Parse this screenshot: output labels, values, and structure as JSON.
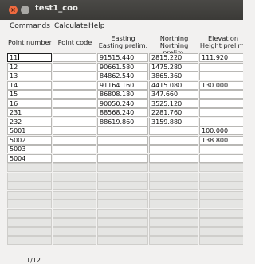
{
  "window": {
    "title": "test1_coo"
  },
  "menu": {
    "items": [
      "Commands",
      "Calculate",
      "Help"
    ]
  },
  "table": {
    "headers": [
      {
        "line1": "Point number",
        "line2": ""
      },
      {
        "line1": "Point code",
        "line2": ""
      },
      {
        "line1": "Easting",
        "line2": "Easting prelim."
      },
      {
        "line1": "Northing",
        "line2": "Northing prelim."
      },
      {
        "line1": "Elevation",
        "line2": "Height prelim."
      }
    ],
    "rows": [
      [
        "11",
        "",
        "91515.440",
        "2815.220",
        "111.920"
      ],
      [
        "12",
        "",
        "90661.580",
        "1475.280",
        ""
      ],
      [
        "13",
        "",
        "84862.540",
        "3865.360",
        ""
      ],
      [
        "14",
        "",
        "91164.160",
        "4415.080",
        "130.000"
      ],
      [
        "15",
        "",
        "86808.180",
        "347.660",
        ""
      ],
      [
        "16",
        "",
        "90050.240",
        "3525.120",
        ""
      ],
      [
        "231",
        "",
        "88568.240",
        "2281.760",
        ""
      ],
      [
        "232",
        "",
        "88619.860",
        "3159.880",
        ""
      ],
      [
        "5001",
        "",
        "",
        "",
        "100.000"
      ],
      [
        "5002",
        "",
        "",
        "",
        "138.800"
      ],
      [
        "5003",
        "",
        "",
        "",
        ""
      ],
      [
        "5004",
        "",
        "",
        "",
        ""
      ],
      [
        "",
        "",
        "",
        "",
        ""
      ],
      [
        "",
        "",
        "",
        "",
        ""
      ],
      [
        "",
        "",
        "",
        "",
        ""
      ],
      [
        "",
        "",
        "",
        "",
        ""
      ],
      [
        "",
        "",
        "",
        "",
        ""
      ],
      [
        "",
        "",
        "",
        "",
        ""
      ],
      [
        "",
        "",
        "",
        "",
        ""
      ],
      [
        "",
        "",
        "",
        "",
        ""
      ],
      [
        "",
        "",
        "",
        "",
        ""
      ]
    ]
  },
  "status": {
    "page": "1/12"
  },
  "icons": {
    "close": "close-icon",
    "minimize": "minimize-icon"
  },
  "colors": {
    "titlebar": "#3b3a37",
    "close": "#ef6a3f",
    "window_bg": "#f2f1f0"
  }
}
